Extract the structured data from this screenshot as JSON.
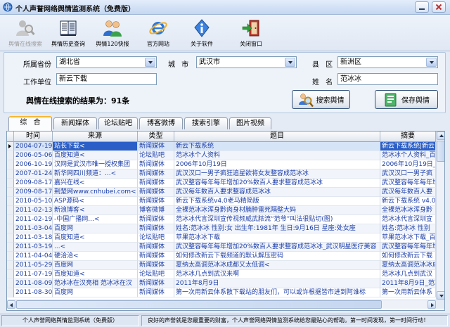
{
  "window": {
    "title": "个人声誉网络舆情监测系统（免费版）",
    "app_icon": "app-globe-icon",
    "minimize_icon": "minimize-icon",
    "close_icon": "close-icon"
  },
  "toolbar": {
    "items": [
      {
        "label": "舆情在线搜索",
        "icon": "online-search-icon",
        "enabled": false
      },
      {
        "label": "舆情历史查询",
        "icon": "history-query-icon",
        "enabled": true
      },
      {
        "label": "舆情120快报",
        "icon": "quick-report-icon",
        "enabled": true
      },
      {
        "label": "官方网站",
        "icon": "ie-browser-icon",
        "enabled": true
      },
      {
        "label": "关于软件",
        "icon": "about-icon",
        "enabled": true
      },
      {
        "label": "关闭窗口",
        "icon": "exit-door-icon",
        "enabled": true
      }
    ]
  },
  "form": {
    "province": {
      "label": "所属省份",
      "value": "湖北省"
    },
    "city": {
      "label": "城 市",
      "value": "武汉市"
    },
    "district": {
      "label": "县 区",
      "value": "新洲区"
    },
    "employer": {
      "label": "工作单位",
      "value": "新云下载"
    },
    "name": {
      "label": "姓 名",
      "value": "范冰冰"
    },
    "result_text": "舆情在线搜索的结果为：91条",
    "search_button": {
      "label": "搜索舆情",
      "icon": "search-people-icon"
    },
    "save_button": {
      "label": "保存舆情",
      "icon": "save-document-icon"
    }
  },
  "tabs": [
    {
      "label": "综 合",
      "selected": true
    },
    {
      "label": "新闻媒体",
      "selected": false
    },
    {
      "label": "论坛贴吧",
      "selected": false
    },
    {
      "label": "博客微博",
      "selected": false
    },
    {
      "label": "搜索引擎",
      "selected": false
    },
    {
      "label": "图片视频",
      "selected": false
    }
  ],
  "grid": {
    "columns": [
      "时间",
      "来源",
      "类型",
      "题目",
      "摘要"
    ],
    "selected_row": 0,
    "rows": [
      {
        "time": "2004-07-19",
        "source": "站长下载<",
        "type": "新闻媒体",
        "title": "新云下载系统",
        "summary": "新云下载系统|新云"
      },
      {
        "time": "2006-05-06",
        "source": "百度知道<",
        "type": "论坛贴吧",
        "title": "范冰冰个人资料",
        "summary": "范冰冰个人资料_百"
      },
      {
        "time": "2006-10-19",
        "source": "汉网是武汉市唯一授权集团",
        "type": "新闻媒体",
        "title": "2006年10月19日",
        "summary": "2006年10月19日_汉"
      },
      {
        "time": "2007-01-24",
        "source": "新华网四川频道：...<",
        "type": "新闻媒体",
        "title": "武汉汉口一男子疯狂追星欲将女友整容成范冰冰",
        "summary": "武汉汉口一男子疯"
      },
      {
        "time": "2009-08-17",
        "source": "嘉兴在线<",
        "type": "新闻媒体",
        "title": "武汉整容每年每年增加20%数百人要求整容成范冰冰",
        "summary": "武汉整容每年每年增"
      },
      {
        "time": "2009-08-17",
        "source": "荆楚网www.cnhubei.com<",
        "type": "新闻媒体",
        "title": "武汉每年数百人要求整容成范冰冰",
        "summary": "武汉每年数百人要"
      },
      {
        "time": "2010-05-10",
        "source": "ASP源码<",
        "type": "新闻媒体",
        "title": "新云下载系统v4.0老马精简版",
        "summary": "新云下载系统 v4.0"
      },
      {
        "time": "2011-02-13",
        "source": "新浪博客<",
        "type": "博客微博",
        "title": "全裸范冰冰浑身黔肉身材腩肿雷死隔壁大妈",
        "summary": "全裸范冰冰浑身黔"
      },
      {
        "time": "2011-02-19",
        "source": "-中国广播网...<",
        "type": "新闻媒体",
        "title": "范冰冰代言深圳宣传视频威武脓流“范爷”叫法很贴切(图)",
        "summary": "范冰冰代言深圳宣"
      },
      {
        "time": "2011-03-04",
        "source": "百度网",
        "type": "新闻媒体",
        "title": "姓名:范冰冰 性别:女 出生年:1981年 生日:9月16日 星座:处女座",
        "summary": "姓名:范冰冰 性别"
      },
      {
        "time": "2011-03-18",
        "source": "百度知道<",
        "type": "论坛贴吧",
        "title": "苹果范冰冰下载",
        "summary": "苹果范冰冰下载_百"
      },
      {
        "time": "2011-03-19",
        "source": "...<",
        "type": "新闻媒体",
        "title": "武汉整容每年每年增加20%数百人要求整容成范冰冰_武汉明星医疗美容",
        "summary": "武汉整容每年每年增"
      },
      {
        "time": "2011-04-04",
        "source": "硬洽洽<",
        "type": "新闻媒体",
        "title": "如何修改新云下载频道的默认解压密码",
        "summary": "如何修改新云下载"
      },
      {
        "time": "2011-05-29",
        "source": "百度网",
        "type": "新闻媒体",
        "title": "夏纳太高调范冰冰成都又太低调<",
        "summary": "夏纳太高调范冰冰成"
      },
      {
        "time": "2011-07-19",
        "source": "百度知道<",
        "type": "论坛贴吧",
        "title": "范冰冰几点到武汉来啊",
        "summary": "范冰冰几点到武汉"
      },
      {
        "time": "2011-08-09",
        "source": "范冰冰在汉亮相 范冰冰在汉",
        "type": "新闻媒体",
        "title": "2011年8月9日",
        "summary": "2011年8月9日_范冰"
      },
      {
        "time": "2011-08-30",
        "source": "百度网",
        "type": "新闻媒体",
        "title": "第一次用新云体系散下载站的朋友们，可以或许根据皆市进到阿谁标",
        "summary": "第一次用新云体系"
      }
    ]
  },
  "statusbar": {
    "app_name": "个人声誉网络舆情监测系统（免费版）",
    "message": "良好的声誉就是您最重要的财富，个人声誉网络舆情监测系统给您最贴心的帮助。第一时间发现，第一时间行动！"
  },
  "colors": {
    "title_bar": "#c4d7f1",
    "window_background": "#e4ebf5",
    "grid_text": "#1d3ea8",
    "selection": "#2b5fc7",
    "selected_row": "#d6e4f7",
    "active_tab_accent": "#f7b733"
  }
}
